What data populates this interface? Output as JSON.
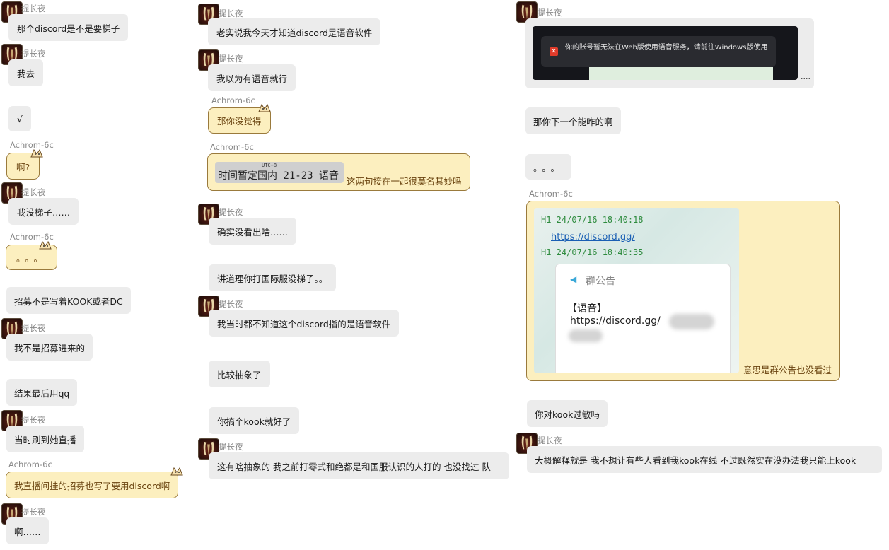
{
  "names": {
    "a": "提长夜",
    "b": "Achrom-6c"
  },
  "col1": [
    {
      "text": "那个discord是不是要梯子"
    },
    {
      "text": "我去"
    },
    {
      "text": "√"
    },
    {
      "text": "啊?"
    },
    {
      "text": "我没梯子……"
    },
    {
      "text": "。。。"
    },
    {
      "text": "招募不是写着KOOK或者DC"
    },
    {
      "text": "我不是招募进来的"
    },
    {
      "text": "结果最后用qq"
    },
    {
      "text": "当时刷到她直播"
    },
    {
      "text": "我直播间挂的招募也写了要用discord啊"
    },
    {
      "text": "啊……"
    }
  ],
  "col2": [
    {
      "text": "老实说我今天才知道discord是语音软件"
    },
    {
      "text": "我以为有语音就行"
    },
    {
      "text": "那你没觉得"
    },
    {
      "text": "这两句接在一起很莫名其妙吗",
      "img_text": "时间暂定国内 21-23 语音",
      "img_small": "UTC+8"
    },
    {
      "text": "确实没看出啥……"
    },
    {
      "text": "讲道理你打国际服没梯子。。"
    },
    {
      "text": "我当时都不知道这个discord指的是语音软件"
    },
    {
      "text": "比较抽象了"
    },
    {
      "text": "你搞个kook就好了"
    },
    {
      "text": "这有啥抽象的 我之前打零式和绝都是和国服认识的人打的 也没找过 队"
    }
  ],
  "col3": [
    {
      "popup": "你的账号暂无法在Web版使用语音服务，请前往Windows版使用",
      "trail": "...."
    },
    {
      "text": "那你下一个能咋的啊"
    },
    {
      "text": "。。。"
    },
    {
      "line1": "H1 24/07/16 18:40:18",
      "link": "https://discord.gg/",
      "line2": "H1 24/07/16 18:40:35",
      "notice_title": "群公告",
      "notice_tag": "【语音】",
      "notice_link": "https://discord.gg/",
      "trail": "意思是群公告也没看过"
    },
    {
      "text": "你对kook过敏吗"
    },
    {
      "text": "大概解释就是  我不想让有些人看到我kook在线  不过既然实在没办法我只能上kook"
    }
  ],
  "colors": {
    "gray_bubble": "#ececec",
    "yellow_bubble": "#fcefbf",
    "yellow_border": "#9a7a3c",
    "link": "#1a5fb4",
    "green_text": "#2e8b3e"
  }
}
